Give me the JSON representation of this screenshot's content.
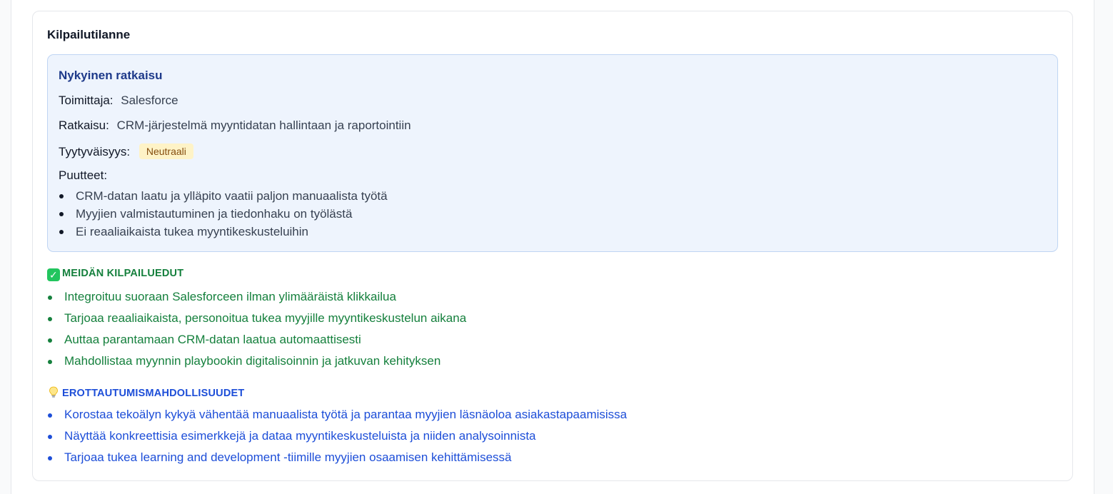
{
  "competition": {
    "title": "Kilpailutilanne",
    "current_solution": {
      "title": "Nykyinen ratkaisu",
      "vendor_label": "Toimittaja:",
      "vendor_value": "Salesforce",
      "solution_label": "Ratkaisu:",
      "solution_value": "CRM-järjestelmä myyntidatan hallintaan ja raportointiin",
      "satisfaction_label": "Tyytyväisyys:",
      "satisfaction_value": "Neutraali",
      "gaps_label": "Puutteet:",
      "gaps": [
        "CRM-datan laatu ja ylläpito vaatii paljon manuaalista työtä",
        "Myyjien valmistautuminen ja tiedonhaku on työlästä",
        "Ei reaaliaikaista tukea myyntikeskusteluihin"
      ]
    },
    "advantages": {
      "icon": "check-mark-icon",
      "title": "MEIDÄN KILPAILUEDUT",
      "items": [
        "Integroituu suoraan Salesforceen ilman ylimääräistä klikkailua",
        "Tarjoaa reaaliaikaista, personoitua tukea myyjille myyntikeskustelun aikana",
        "Auttaa parantamaan CRM-datan laatua automaattisesti",
        "Mahdollistaa myynnin playbookin digitalisoinnin ja jatkuvan kehityksen"
      ]
    },
    "differentiation": {
      "icon": "light-bulb-icon",
      "title": "EROTTAUTUMISMAHDOLLISUUDET",
      "items": [
        "Korostaa tekoälyn kykyä vähentää manuaalista työtä ja parantaa myyjien läsnäoloa asiakastapaamisissa",
        "Näyttää konkreettisia esimerkkejä ja dataa myyntikeskusteluista ja niiden analysoinnista",
        "Tarjoaa tukea learning and development -tiimille myyjien osaamisen kehittämisessä"
      ]
    }
  },
  "colors": {
    "advantage": "#15803d",
    "differentiation": "#1d4ed8",
    "current_box_bg": "#eef4fd",
    "badge_bg": "#fef3c7"
  }
}
